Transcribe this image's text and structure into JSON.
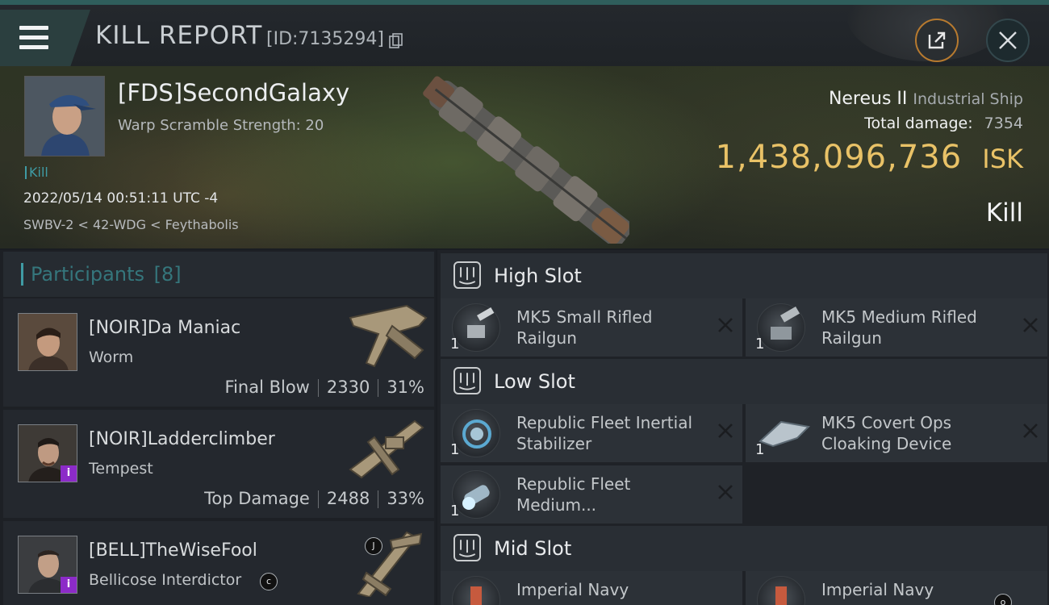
{
  "header": {
    "title": "KILL REPORT",
    "report_id": "[ID:7135294]"
  },
  "victim": {
    "name": "[FDS]SecondGalaxy",
    "warp_scramble": "Warp Scramble Strength: 20",
    "kill_tag": "Kill",
    "datetime": "2022/05/14 00:51:11 UTC -4",
    "location": "SWBV-2 < 42-WDG < Feythabolis",
    "ship_name": "Nereus II",
    "ship_class": "Industrial Ship",
    "total_damage_label": "Total damage:",
    "total_damage_value": "7354",
    "isk_value": "1,438,096,736",
    "isk_unit": "ISK",
    "result_label": "Kill"
  },
  "participants": {
    "title": "Participants",
    "count": "[8]",
    "rows": [
      {
        "name": "[NOIR]Da Maniac",
        "ship": "Worm",
        "role": "Final Blow",
        "damage": "2330",
        "percent": "31%",
        "badge": ""
      },
      {
        "name": "[NOIR]Ladderclimber",
        "ship": "Tempest",
        "role": "Top Damage",
        "damage": "2488",
        "percent": "33%",
        "badge": "i"
      },
      {
        "name": "[BELL]TheWiseFool",
        "ship": "Bellicose Interdictor",
        "role": "",
        "damage": "",
        "percent": "",
        "badge": "i"
      }
    ]
  },
  "slots": {
    "high": {
      "title": "High Slot",
      "modules": [
        {
          "qty": "1",
          "name": "MK5 Small Rifled Railgun"
        },
        {
          "qty": "1",
          "name": "MK5 Medium Rifled Railgun"
        }
      ]
    },
    "low": {
      "title": "Low Slot",
      "modules": [
        {
          "qty": "1",
          "name": "Republic Fleet Inertial Stabilizer"
        },
        {
          "qty": "1",
          "name": "MK5 Covert Ops Cloaking Device"
        },
        {
          "qty": "1",
          "name": "Republic Fleet Medium..."
        }
      ]
    },
    "mid": {
      "title": "Mid Slot",
      "modules": [
        {
          "qty": "",
          "name": "Imperial Navy"
        },
        {
          "qty": "",
          "name": "Imperial Navy"
        }
      ]
    }
  },
  "icons": {
    "menu": "menu-icon",
    "copy": "copy-icon",
    "share": "share-icon",
    "close": "close-icon",
    "remove": "close-x-icon",
    "slot": "slot-icon",
    "small_c": "c",
    "small_j": "J",
    "small_o": "o"
  },
  "colors": {
    "accent": "#3f9ba4",
    "isk": "#e9c267",
    "share_border": "#b77a2f",
    "badge": "#8c2bc8"
  }
}
